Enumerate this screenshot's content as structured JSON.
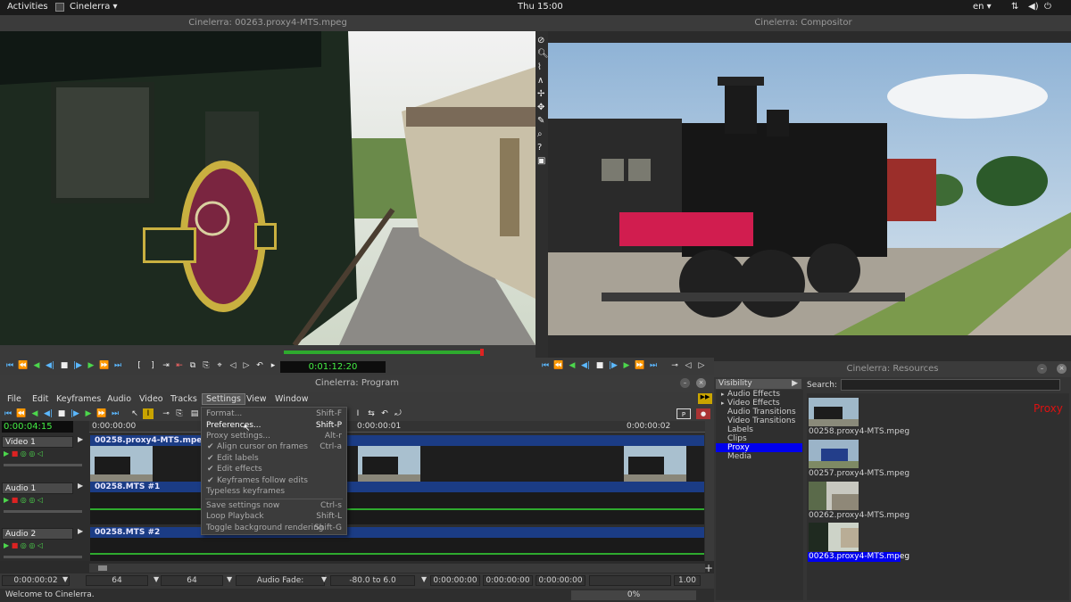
{
  "topbar": {
    "activities": "Activities",
    "app_menu": "Cinelerra ▾",
    "clock": "Thu 15:00",
    "lang": "en ▾"
  },
  "viewer": {
    "title": "Cinelerra: 00263.proxy4-MTS.mpeg",
    "timecode": "0:01:12:20"
  },
  "compositor": {
    "title": "Cinelerra: Compositor"
  },
  "resources": {
    "title": "Cinelerra: Resources",
    "visibility_label": "Visibility",
    "search_label": "Search:",
    "search_value": "",
    "folders": [
      "Audio Effects",
      "Video Effects",
      "Audio Transitions",
      "Video Transitions",
      "Labels",
      "Clips",
      "Proxy",
      "Media"
    ],
    "selected_folder": "Proxy",
    "proxy_label": "Proxy",
    "items": [
      "00258.proxy4-MTS.mpeg",
      "00257.proxy4-MTS.mpeg",
      "00262.proxy4-MTS.mpeg",
      "00263.proxy4-MTS.mpeg"
    ]
  },
  "program": {
    "title": "Cinelerra: Program",
    "menus": [
      "File",
      "Edit",
      "Keyframes",
      "Audio",
      "Video",
      "Tracks",
      "Settings",
      "View",
      "Window"
    ],
    "timecode": "0:00:04:15",
    "ruler": [
      "0:00:00:00",
      "0:00:00:01",
      "0:00:00:02"
    ],
    "tracks": [
      {
        "name": "Video 1",
        "clip": "00258.proxy4-MTS.mpeg"
      },
      {
        "name": "Audio 1",
        "clip": "00258.MTS #1"
      },
      {
        "name": "Audio 2",
        "clip": "00258.MTS #2"
      }
    ],
    "status": {
      "position": "0:00:00:02",
      "v1": "64",
      "v2": "64",
      "fade_label": "Audio Fade:",
      "fade_range": "-80.0 to 6.0",
      "t1": "0:00:00:00",
      "t2": "0:00:00:00",
      "t3": "0:00:00:00",
      "zoom": "1.00",
      "message": "Welcome to Cinelerra.",
      "progress": "0%"
    }
  },
  "settings_menu": [
    {
      "label": "Format...",
      "shortcut": "Shift-F",
      "check": ""
    },
    {
      "label": "Preferences...",
      "shortcut": "Shift-P",
      "check": ""
    },
    {
      "label": "Proxy settings...",
      "shortcut": "Alt-r",
      "check": ""
    },
    {
      "label": "Align cursor on frames",
      "shortcut": "Ctrl-a",
      "check": "✔"
    },
    {
      "label": "Edit labels",
      "shortcut": "",
      "check": "✔"
    },
    {
      "label": "Edit effects",
      "shortcut": "",
      "check": "✔"
    },
    {
      "label": "Keyframes follow edits",
      "shortcut": "",
      "check": "✔"
    },
    {
      "label": "Typeless keyframes",
      "shortcut": "",
      "check": ""
    },
    {
      "label": "Save settings now",
      "shortcut": "Ctrl-s",
      "check": ""
    },
    {
      "label": "Loop Playback",
      "shortcut": "Shift-L",
      "check": ""
    },
    {
      "label": "Toggle background rendering",
      "shortcut": "Shift-G",
      "check": ""
    }
  ],
  "colors": {
    "accent": "#1b3c85",
    "selection": "#0000ee",
    "timecode": "#44ee44",
    "proxy_red": "#dd1111"
  }
}
